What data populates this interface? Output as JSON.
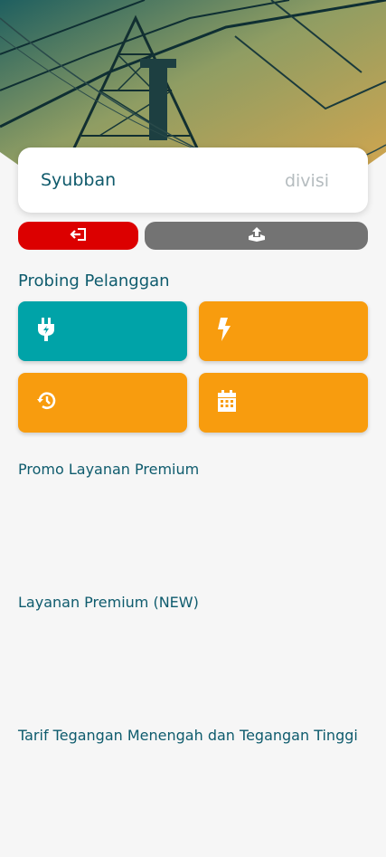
{
  "header": {
    "hero_image": "electrical-substation-photo"
  },
  "profile": {
    "name": "Syubban",
    "division": "divisi"
  },
  "actions": {
    "logout_icon": "logout-icon",
    "upload_icon": "upload-icon"
  },
  "probing": {
    "title": "Probing Pelanggan",
    "tiles": [
      {
        "icon": "plug-icon",
        "color": "#00a3a8"
      },
      {
        "icon": "bolt-icon",
        "color": "#f89c0e"
      },
      {
        "icon": "history-icon",
        "color": "#f89c0e"
      },
      {
        "icon": "calendar-icon",
        "color": "#f89c0e"
      }
    ]
  },
  "sections": {
    "promo_title": "Promo Layanan Premium",
    "premium_title": "Layanan Premium (NEW)",
    "tariff_title": "Tarif Tegangan Menengah dan Tegangan Tinggi"
  }
}
